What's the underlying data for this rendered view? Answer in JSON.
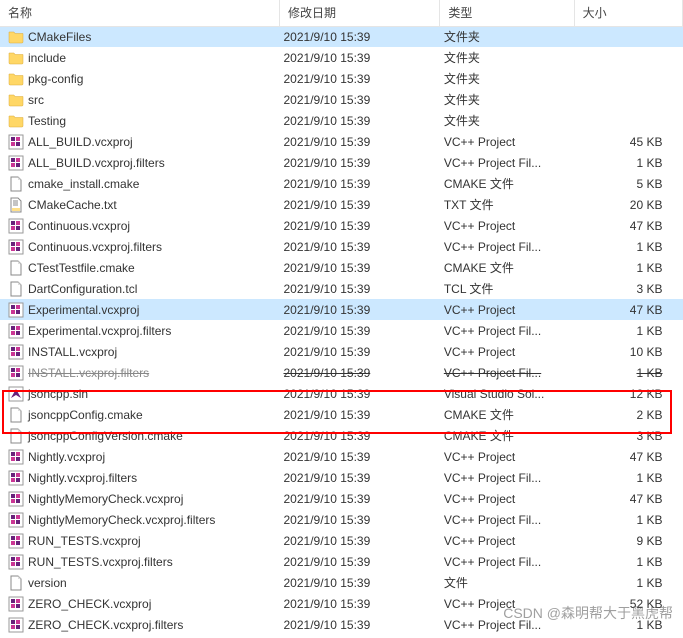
{
  "columns": {
    "name": "名称",
    "date": "修改日期",
    "type": "类型",
    "size": "大小"
  },
  "watermark": "CSDN @森明帮大于黑虎帮",
  "files": [
    {
      "name": "CMakeFiles",
      "date": "2021/9/10 15:39",
      "type": "文件夹",
      "size": "",
      "icon": "folder",
      "selected": true
    },
    {
      "name": "include",
      "date": "2021/9/10 15:39",
      "type": "文件夹",
      "size": "",
      "icon": "folder"
    },
    {
      "name": "pkg-config",
      "date": "2021/9/10 15:39",
      "type": "文件夹",
      "size": "",
      "icon": "folder"
    },
    {
      "name": "src",
      "date": "2021/9/10 15:39",
      "type": "文件夹",
      "size": "",
      "icon": "folder"
    },
    {
      "name": "Testing",
      "date": "2021/9/10 15:39",
      "type": "文件夹",
      "size": "",
      "icon": "folder"
    },
    {
      "name": "ALL_BUILD.vcxproj",
      "date": "2021/9/10 15:39",
      "type": "VC++ Project",
      "size": "45 KB",
      "icon": "vcxproj"
    },
    {
      "name": "ALL_BUILD.vcxproj.filters",
      "date": "2021/9/10 15:39",
      "type": "VC++ Project Fil...",
      "size": "1 KB",
      "icon": "vcxproj"
    },
    {
      "name": "cmake_install.cmake",
      "date": "2021/9/10 15:39",
      "type": "CMAKE 文件",
      "size": "5 KB",
      "icon": "file"
    },
    {
      "name": "CMakeCache.txt",
      "date": "2021/9/10 15:39",
      "type": "TXT 文件",
      "size": "20 KB",
      "icon": "txt"
    },
    {
      "name": "Continuous.vcxproj",
      "date": "2021/9/10 15:39",
      "type": "VC++ Project",
      "size": "47 KB",
      "icon": "vcxproj"
    },
    {
      "name": "Continuous.vcxproj.filters",
      "date": "2021/9/10 15:39",
      "type": "VC++ Project Fil...",
      "size": "1 KB",
      "icon": "vcxproj"
    },
    {
      "name": "CTestTestfile.cmake",
      "date": "2021/9/10 15:39",
      "type": "CMAKE 文件",
      "size": "1 KB",
      "icon": "file"
    },
    {
      "name": "DartConfiguration.tcl",
      "date": "2021/9/10 15:39",
      "type": "TCL 文件",
      "size": "3 KB",
      "icon": "file"
    },
    {
      "name": "Experimental.vcxproj",
      "date": "2021/9/10 15:39",
      "type": "VC++ Project",
      "size": "47 KB",
      "icon": "vcxproj",
      "selected": true
    },
    {
      "name": "Experimental.vcxproj.filters",
      "date": "2021/9/10 15:39",
      "type": "VC++ Project Fil...",
      "size": "1 KB",
      "icon": "vcxproj"
    },
    {
      "name": "INSTALL.vcxproj",
      "date": "2021/9/10 15:39",
      "type": "VC++ Project",
      "size": "10 KB",
      "icon": "vcxproj"
    },
    {
      "name": "INSTALL.vcxproj.filters",
      "date": "2021/9/10 15:39",
      "type": "VC++ Project Fil...",
      "size": "1 KB",
      "icon": "vcxproj",
      "strike": true
    },
    {
      "name": "jsoncpp.sln",
      "date": "2021/9/10 15:39",
      "type": "Visual Studio Sol...",
      "size": "12 KB",
      "icon": "sln"
    },
    {
      "name": "jsoncppConfig.cmake",
      "date": "2021/9/10 15:39",
      "type": "CMAKE 文件",
      "size": "2 KB",
      "icon": "file"
    },
    {
      "name": "jsoncppConfigVersion.cmake",
      "date": "2021/9/10 15:39",
      "type": "CMAKE 文件",
      "size": "3 KB",
      "icon": "file"
    },
    {
      "name": "Nightly.vcxproj",
      "date": "2021/9/10 15:39",
      "type": "VC++ Project",
      "size": "47 KB",
      "icon": "vcxproj"
    },
    {
      "name": "Nightly.vcxproj.filters",
      "date": "2021/9/10 15:39",
      "type": "VC++ Project Fil...",
      "size": "1 KB",
      "icon": "vcxproj"
    },
    {
      "name": "NightlyMemoryCheck.vcxproj",
      "date": "2021/9/10 15:39",
      "type": "VC++ Project",
      "size": "47 KB",
      "icon": "vcxproj"
    },
    {
      "name": "NightlyMemoryCheck.vcxproj.filters",
      "date": "2021/9/10 15:39",
      "type": "VC++ Project Fil...",
      "size": "1 KB",
      "icon": "vcxproj"
    },
    {
      "name": "RUN_TESTS.vcxproj",
      "date": "2021/9/10 15:39",
      "type": "VC++ Project",
      "size": "9 KB",
      "icon": "vcxproj"
    },
    {
      "name": "RUN_TESTS.vcxproj.filters",
      "date": "2021/9/10 15:39",
      "type": "VC++ Project Fil...",
      "size": "1 KB",
      "icon": "vcxproj"
    },
    {
      "name": "version",
      "date": "2021/9/10 15:39",
      "type": "文件",
      "size": "1 KB",
      "icon": "file"
    },
    {
      "name": "ZERO_CHECK.vcxproj",
      "date": "2021/9/10 15:39",
      "type": "VC++ Project",
      "size": "52 KB",
      "icon": "vcxproj"
    },
    {
      "name": "ZERO_CHECK.vcxproj.filters",
      "date": "2021/9/10 15:39",
      "type": "VC++ Project Fil...",
      "size": "1 KB",
      "icon": "vcxproj"
    }
  ]
}
